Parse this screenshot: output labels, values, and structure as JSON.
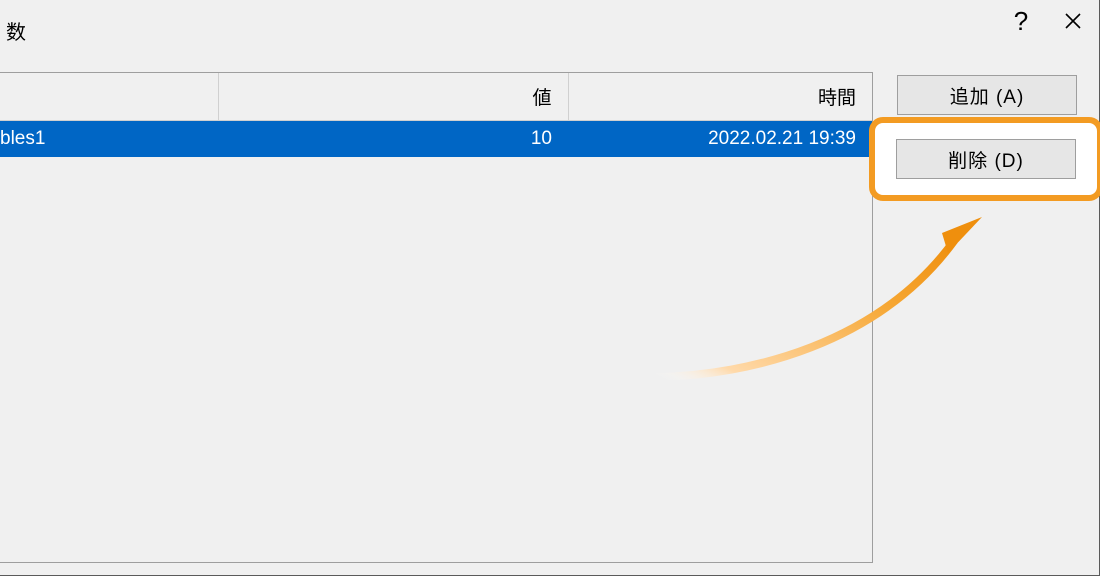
{
  "titlebar": {
    "fragment": "数",
    "help_symbol": "?",
    "close_label": "close"
  },
  "table": {
    "columns": {
      "name": "",
      "value": "値",
      "time": "時間"
    },
    "rows": [
      {
        "name": "bles1",
        "value": "10",
        "time": "2022.02.21 19:39"
      }
    ]
  },
  "buttons": {
    "add": "追加 (A)",
    "delete": "削除 (D)"
  },
  "colors": {
    "selection_bg": "#0066c5",
    "highlight": "#f39b22"
  }
}
